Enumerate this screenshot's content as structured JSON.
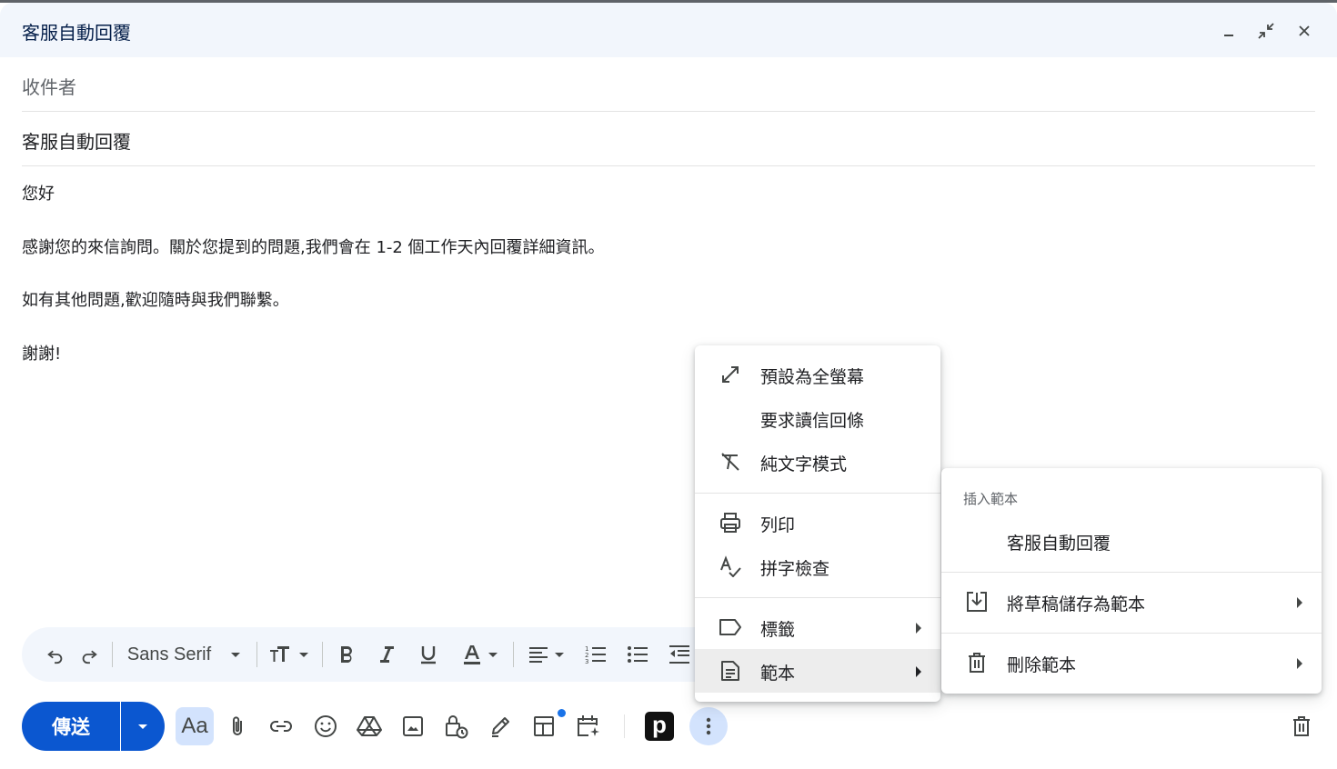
{
  "window": {
    "title": "客服自動回覆",
    "icons": [
      "minimize-icon",
      "exit-fullscreen-icon",
      "close-icon"
    ]
  },
  "compose": {
    "to_placeholder": "收件者",
    "subject": "客服自動回覆",
    "body_lines": [
      "您好",
      "感謝您的來信詢問。關於您提到的問題,我們會在 1-2 個工作天內回覆詳細資訊。",
      "如有其他問題,歡迎隨時與我們聯繫。",
      "謝謝!"
    ]
  },
  "format_toolbar": {
    "font_name": "Sans Serif",
    "icons": [
      "undo-icon",
      "redo-icon",
      "font-dropdown-icon",
      "text-size-icon",
      "bold-icon",
      "italic-icon",
      "underline-icon",
      "text-color-icon",
      "align-icon",
      "numbered-list-icon",
      "bulleted-list-icon",
      "indent-less-icon"
    ]
  },
  "bottom_bar": {
    "send_label": "傳送",
    "formatting_label": "Aa",
    "pushbullet_label": "p",
    "icons": [
      "attach-icon",
      "link-icon",
      "emoji-icon",
      "drive-icon",
      "photo-icon",
      "confidential-icon",
      "signature-icon",
      "layouts-icon",
      "schedule-icon",
      "pushbullet-icon",
      "more-options-icon",
      "discard-icon"
    ]
  },
  "more_menu": {
    "items": [
      {
        "label": "預設為全螢幕",
        "icon": "fullscreen-icon"
      },
      {
        "label": "要求讀信回條",
        "icon": ""
      },
      {
        "label": "純文字模式",
        "icon": "plain-text-icon"
      },
      {
        "label": "列印",
        "icon": "print-icon"
      },
      {
        "label": "拼字檢查",
        "icon": "spellcheck-icon"
      },
      {
        "label": "標籤",
        "icon": "label-icon"
      },
      {
        "label": "範本",
        "icon": "template-icon"
      }
    ]
  },
  "template_submenu": {
    "heading": "插入範本",
    "template_item": "客服自動回覆",
    "save_as_template": "將草稿儲存為範本",
    "delete_template": "刪除範本"
  },
  "colors": {
    "accent": "#0b57d0",
    "header_bg": "#f2f6fc",
    "accent_light": "#d3e3fd",
    "notification_dot": "#1a73e8"
  }
}
